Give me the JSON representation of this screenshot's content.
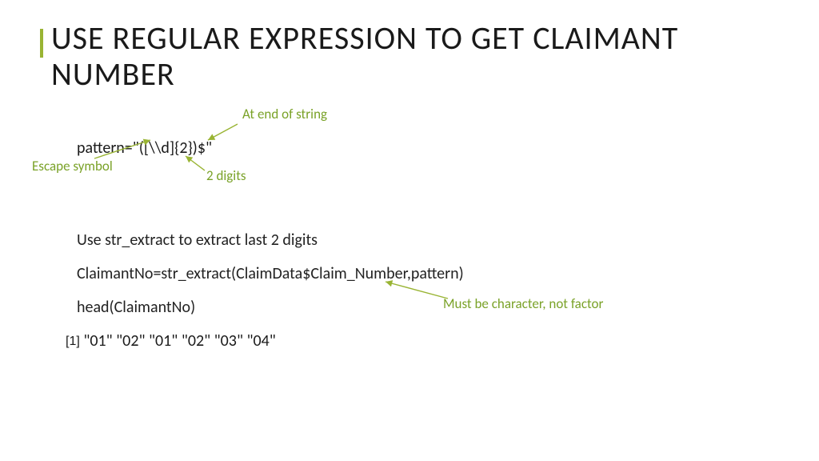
{
  "title": "USE REGULAR EXPRESSION TO GET CLAIMANT NUMBER",
  "pattern_line": "pattern=\"([\\\\d]{2})$\"",
  "annotations": {
    "end": "At end of string",
    "escape": "Escape symbol",
    "digits": "2 digits",
    "must": "Must be character, not factor"
  },
  "body": {
    "line1": "Use str_extract to extract last 2 digits",
    "line2": "ClaimantNo=str_extract(ClaimData$Claim_Number,pattern)",
    "line3": "head(ClaimantNo)"
  },
  "output": {
    "bracket": "[1]",
    "values": "\"01\" \"02\" \"01\" \"02\" \"03\" \"04\""
  }
}
